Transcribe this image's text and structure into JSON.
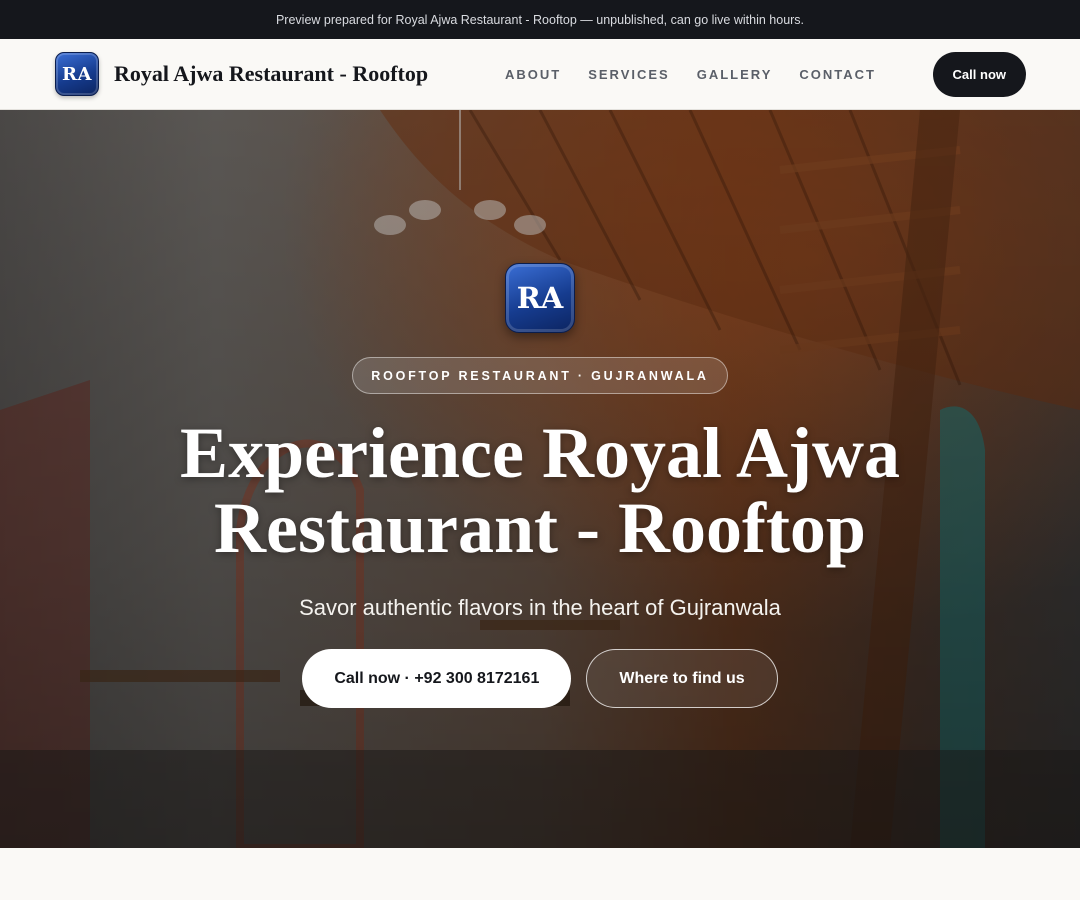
{
  "banner": {
    "text": "Preview prepared for Royal Ajwa Restaurant - Rooftop — unpublished, can go live within hours."
  },
  "brand": {
    "initials": "RA",
    "name": "Royal Ajwa Restaurant - Rooftop"
  },
  "nav": {
    "links": [
      "ABOUT",
      "SERVICES",
      "GALLERY",
      "CONTACT"
    ],
    "cta": "Call now"
  },
  "hero": {
    "badge_initials": "RA",
    "eyebrow": "ROOFTOP RESTAURANT · GUJRANWALA",
    "title": "Experience Royal Ajwa Restaurant - Rooftop",
    "subtitle": "Savor authentic flavors in the heart of Gujranwala",
    "primary_button": "Call now · +92 300 8172161",
    "secondary_button": "Where to find us",
    "background_image": "restaurant-interior-photo"
  },
  "colors": {
    "dark": "#15171c",
    "cream": "#faf9f6",
    "badge_blue": "#163c8f",
    "muted_nav": "#5a5f68"
  }
}
